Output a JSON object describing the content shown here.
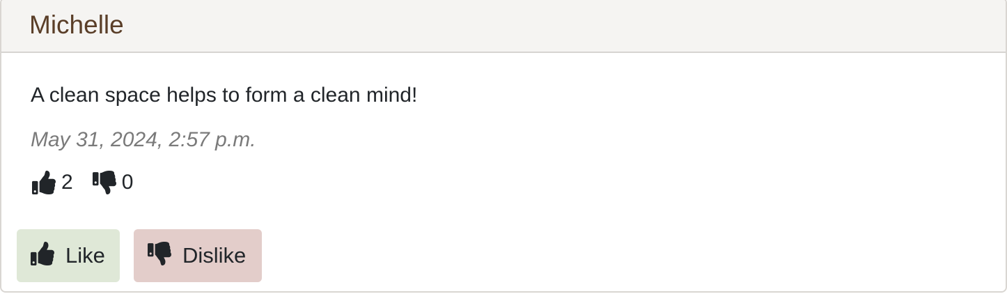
{
  "comment": {
    "author": "Michelle",
    "text": "A clean space helps to form a clean mind!",
    "timestamp": "May 31, 2024, 2:57 p.m.",
    "likes_count": "2",
    "dislikes_count": "0"
  },
  "actions": {
    "like_label": "Like",
    "dislike_label": "Dislike",
    "like_icon": "thumbs-up-icon",
    "dislike_icon": "thumbs-down-icon"
  },
  "colors": {
    "author": "#5a3e28",
    "header_bg": "#f5f4f2",
    "like_bg": "#dfe8d7",
    "dislike_bg": "#e3cdca",
    "timestamp": "#7a7a7a"
  }
}
